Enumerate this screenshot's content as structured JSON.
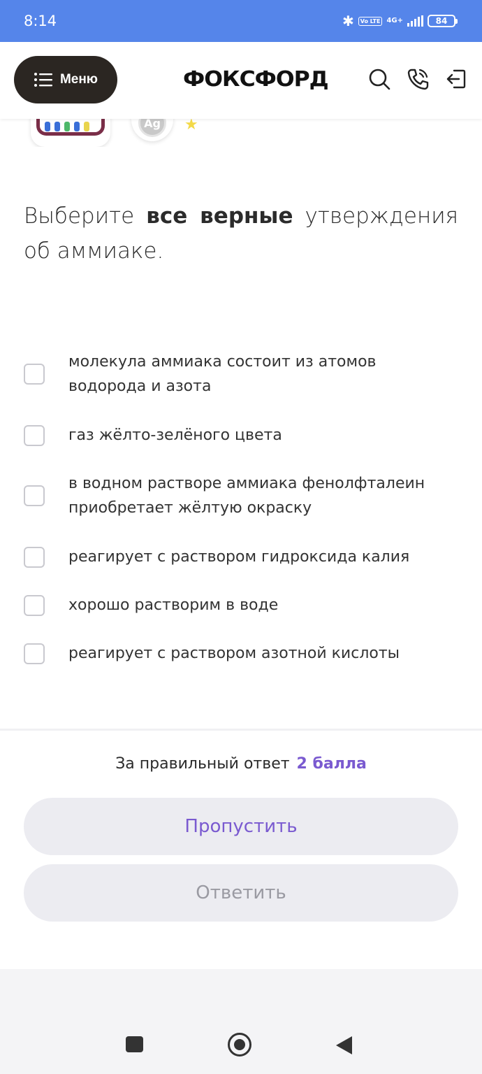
{
  "status_bar": {
    "time": "8:14",
    "network": "4G+",
    "volte": "Vo LTE",
    "battery": "84"
  },
  "header": {
    "menu_label": "Меню",
    "logo": "ФОКСФОРД"
  },
  "badges": {
    "ag_label": "Ag"
  },
  "question": {
    "prefix": "Выберите ",
    "bold": "все верные",
    "suffix": " утверждения об аммиаке."
  },
  "options": [
    {
      "label": "молекула аммиака состоит из атомов водорода и азота",
      "checked": false
    },
    {
      "label": "газ жёлто-зелёного цвета",
      "checked": false
    },
    {
      "label": "в водном растворе аммиака фенолфталеин приобретает жёлтую окраску",
      "checked": false
    },
    {
      "label": "реагирует с раствором гидроксида калия",
      "checked": false
    },
    {
      "label": "хорошо растворим в воде",
      "checked": false
    },
    {
      "label": "реагирует с раствором азотной кислоты",
      "checked": false
    }
  ],
  "footer": {
    "points_text": "За правильный ответ",
    "points_value": "2 балла",
    "skip_label": "Пропустить",
    "answer_label": "Ответить"
  },
  "colors": {
    "status_bar": "#5585ea",
    "accent": "#7a5ad0",
    "menu_button": "#2b2622",
    "button_bg": "#ececf1"
  }
}
